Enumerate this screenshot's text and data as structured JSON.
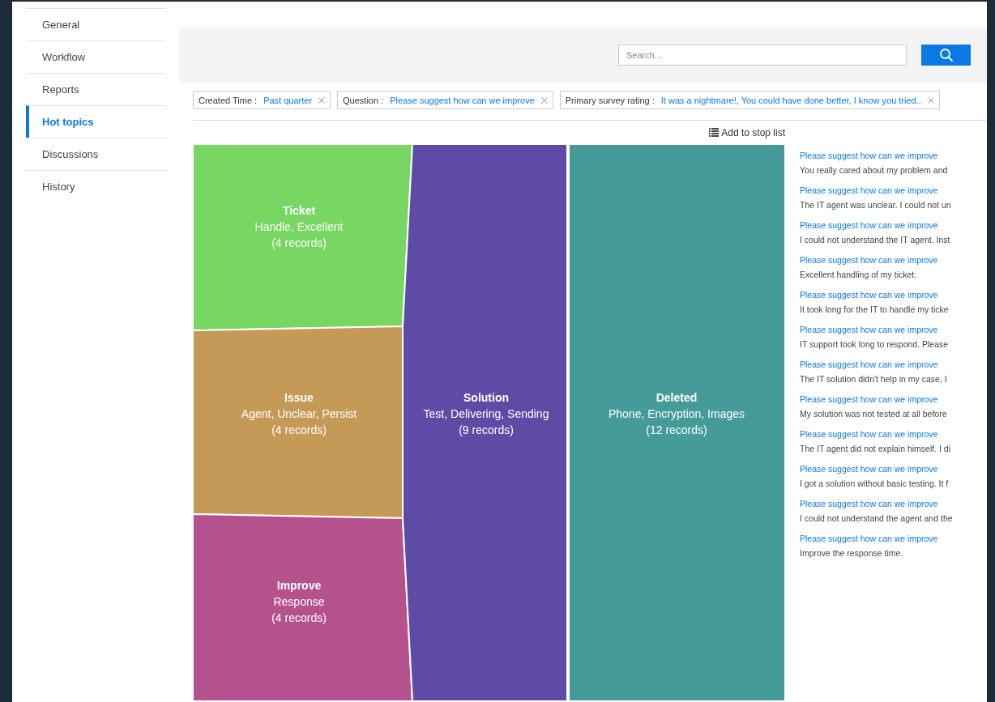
{
  "sidebar": {
    "items": [
      {
        "label": "General",
        "selected": false
      },
      {
        "label": "Workflow",
        "selected": false
      },
      {
        "label": "Reports",
        "selected": false
      },
      {
        "label": "Hot topics",
        "selected": true
      },
      {
        "label": "Discussions",
        "selected": false
      },
      {
        "label": "History",
        "selected": false
      }
    ]
  },
  "search": {
    "placeholder": "Search..."
  },
  "filters": [
    {
      "label": "Created Time :",
      "value": "Past quarter"
    },
    {
      "label": "Question :",
      "value": "Please suggest how can we improve"
    },
    {
      "label": "Primary survey rating :",
      "value": "It was a nightmare!, You could have done better, I know you tried.."
    }
  ],
  "stop_list_button": "Add to stop list",
  "topics": [
    {
      "title": "Ticket",
      "keywords": "Handle, Excellent",
      "records": "(4 records)",
      "color": "#78d662"
    },
    {
      "title": "Issue",
      "keywords": "Agent, Unclear, Persist",
      "records": "(4 records)",
      "color": "#c59a57"
    },
    {
      "title": "Improve",
      "keywords": "Response",
      "records": "(4 records)",
      "color": "#b5518d"
    },
    {
      "title": "Solution",
      "keywords": "Test, Delivering, Sending",
      "records": "(9 records)",
      "color": "#5e4ba6"
    },
    {
      "title": "Deleted",
      "keywords": "Phone, Encryption, Images",
      "records": "(12 records)",
      "color": "#459b99"
    }
  ],
  "comments": [
    {
      "question": "Please suggest how can we improve",
      "text": "You really cared about my problem and"
    },
    {
      "question": "Please suggest how can we improve",
      "text": "The IT agent was unclear. I could not un"
    },
    {
      "question": "Please suggest how can we improve",
      "text": "I could not understand the IT agent. Inst"
    },
    {
      "question": "Please suggest how can we improve",
      "text": "Excellent handling of my ticket."
    },
    {
      "question": "Please suggest how can we improve",
      "text": "It took long for the IT to handle my ticke"
    },
    {
      "question": "Please suggest how can we improve",
      "text": "IT support took long to respond. Please"
    },
    {
      "question": "Please suggest how can we improve",
      "text": "The IT solution didn't help in my case, I"
    },
    {
      "question": "Please suggest how can we improve",
      "text": "My solution was not tested at all before"
    },
    {
      "question": "Please suggest how can we improve",
      "text": "The IT agent did not explain himself. I di"
    },
    {
      "question": "Please suggest how can we improve",
      "text": "I got a solution without basic testing. It f"
    },
    {
      "question": "Please suggest how can we improve",
      "text": "I could not understand the agent and the"
    },
    {
      "question": "Please suggest how can we improve",
      "text": "Improve the response time."
    }
  ]
}
